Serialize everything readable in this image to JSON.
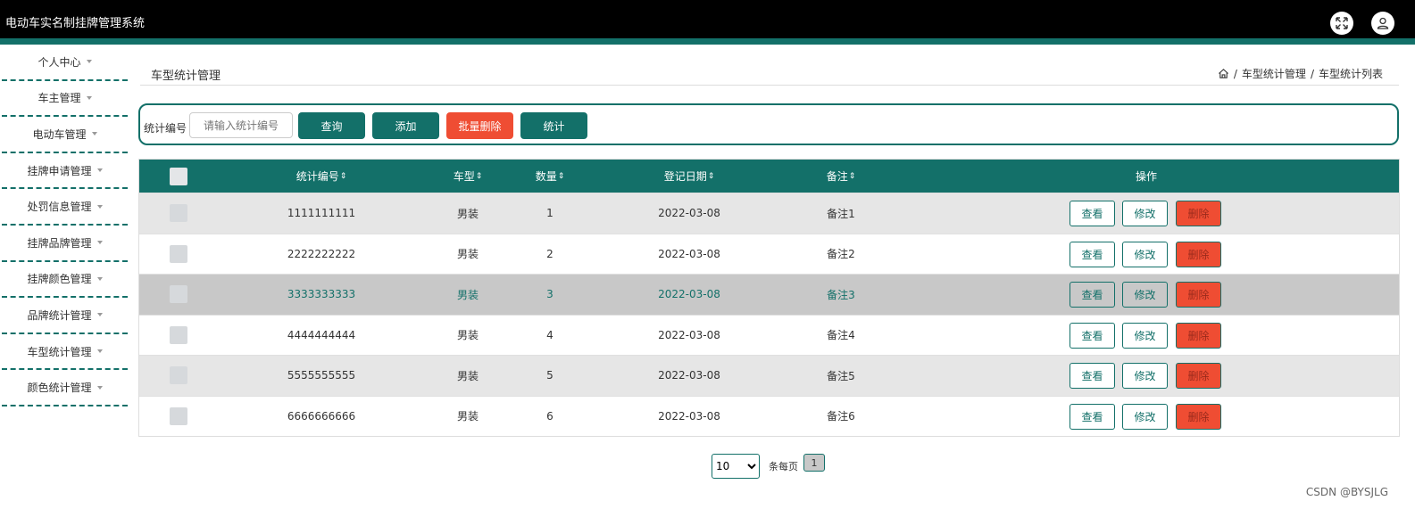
{
  "app": {
    "title": "电动车实名制挂牌管理系统",
    "accent": "#137069",
    "danger": "#ef4d33"
  },
  "header_icons": [
    "fullscreen-icon",
    "user-icon"
  ],
  "sidebar": {
    "items": [
      {
        "label": "个人中心"
      },
      {
        "label": "车主管理"
      },
      {
        "label": "电动车管理"
      },
      {
        "label": "挂牌申请管理"
      },
      {
        "label": "处罚信息管理"
      },
      {
        "label": "挂牌品牌管理"
      },
      {
        "label": "挂牌颜色管理"
      },
      {
        "label": "品牌统计管理"
      },
      {
        "label": "车型统计管理"
      },
      {
        "label": "颜色统计管理"
      }
    ]
  },
  "page": {
    "title": "车型统计管理",
    "breadcrumb": [
      "车型统计管理",
      "车型统计列表"
    ]
  },
  "search": {
    "label": "统计编号",
    "placeholder": "请输入统计编号",
    "buttons": {
      "query": "查询",
      "add": "添加",
      "batch_delete": "批量删除",
      "stats": "统计"
    }
  },
  "table": {
    "columns": {
      "code": "统计编号",
      "model": "车型",
      "count": "数量",
      "date": "登记日期",
      "remark": "备注",
      "ops": "操作"
    },
    "sort_icon": "⇕",
    "rows": [
      {
        "code": "1111111111",
        "model": "男装",
        "count": "1",
        "date": "2022-03-08",
        "remark": "备注1"
      },
      {
        "code": "2222222222",
        "model": "男装",
        "count": "2",
        "date": "2022-03-08",
        "remark": "备注2"
      },
      {
        "code": "3333333333",
        "model": "男装",
        "count": "3",
        "date": "2022-03-08",
        "remark": "备注3"
      },
      {
        "code": "4444444444",
        "model": "男装",
        "count": "4",
        "date": "2022-03-08",
        "remark": "备注4"
      },
      {
        "code": "5555555555",
        "model": "男装",
        "count": "5",
        "date": "2022-03-08",
        "remark": "备注5"
      },
      {
        "code": "6666666666",
        "model": "男装",
        "count": "6",
        "date": "2022-03-08",
        "remark": "备注6"
      }
    ],
    "op_labels": {
      "view": "查看",
      "edit": "修改",
      "delete": "删除"
    }
  },
  "pager": {
    "page_size": "10",
    "per_page_label": "条每页",
    "current_page": "1"
  },
  "watermark": "CSDN @BYSJLG"
}
